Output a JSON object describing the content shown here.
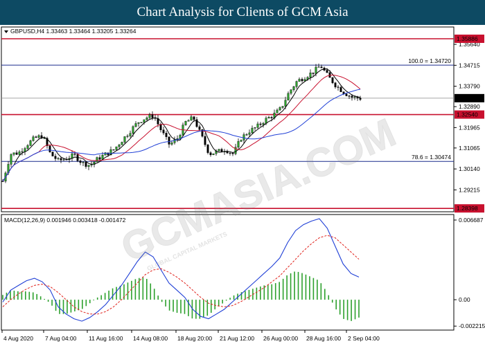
{
  "header": {
    "title": "Chart Analysis for Clients of GCM Asia"
  },
  "watermark": {
    "main": "GCMASIA.COM",
    "sub": "GLOBAL CAPITAL MARKETS"
  },
  "chart_data": [
    {
      "type": "candlestick",
      "info": "GBPUSD,H4  1.33463 1.33464 1.33205 1.33264",
      "ylim": [
        1.2825,
        1.361
      ],
      "y_ticks": [
        "1.35640",
        "1.34715",
        "1.33790",
        "1.32890",
        "1.31965",
        "1.31065",
        "1.30140",
        "1.29215"
      ],
      "x_ticks": [
        "4 Aug 2020",
        "7 Aug 04:00",
        "11 Aug 16:00",
        "14 Aug 08:00",
        "18 Aug 20:00",
        "21 Aug 12:00",
        "26 Aug 00:00",
        "28 Aug 16:00",
        "2 Sep 04:00"
      ],
      "levels": [
        {
          "value": 1.35886,
          "label": "1.35886",
          "color": "#c8102e"
        },
        {
          "value": 1.3254,
          "label": "1.32540",
          "color": "#c8102e"
        },
        {
          "value": 1.28398,
          "label": "1.28398",
          "color": "#c8102e"
        }
      ],
      "fib_levels": [
        {
          "value": 1.3472,
          "text": "100.0 = 1.34720"
        },
        {
          "value": 1.30474,
          "text": "78.6 = 1.30474"
        }
      ],
      "current_price": {
        "value": 1.33264,
        "label": "1.33264"
      },
      "series": [
        {
          "name": "",
          "color": "#000000",
          "key": "ma_fast"
        },
        {
          "name": "",
          "color": "#c8102e",
          "key": "ma_mid"
        },
        {
          "name": "",
          "color": "#1f3fd6",
          "key": "ma_slow"
        }
      ],
      "price_path": [
        1.296,
        1.308,
        1.3085,
        1.312,
        1.315,
        1.316,
        1.308,
        1.305,
        1.306,
        1.3075,
        1.304,
        1.303,
        1.306,
        1.308,
        1.31,
        1.314,
        1.318,
        1.322,
        1.324,
        1.325,
        1.318,
        1.312,
        1.315,
        1.322,
        1.324,
        1.316,
        1.308,
        1.309,
        1.31,
        1.308,
        1.315,
        1.318,
        1.32,
        1.323,
        1.325,
        1.328,
        1.335,
        1.34,
        1.342,
        1.344,
        1.347,
        1.342,
        1.338,
        1.335,
        1.333,
        1.3326
      ]
    },
    {
      "type": "macd",
      "label": "MACD(12,26,9) 0.001946 0.003418 -0.001472",
      "ylim": [
        -0.00255,
        0.00715
      ],
      "y_ticks": [
        "0.006687",
        "0.00",
        "-0.002215"
      ],
      "main_line": [
        -0.0002,
        0.0008,
        0.0012,
        0.0016,
        0.0018,
        0.0015,
        0.0008,
        -0.0006,
        -0.0012,
        -0.0016,
        -0.0018,
        -0.0015,
        -0.001,
        -0.0004,
        0.0004,
        0.0012,
        0.0022,
        0.0032,
        0.004,
        0.0036,
        0.0025,
        0.0014,
        0.0008,
        0.0002,
        -0.0008,
        -0.0014,
        -0.0016,
        -0.0012,
        -0.0008,
        -0.0002,
        0.0004,
        0.001,
        0.0016,
        0.0022,
        0.0028,
        0.0035,
        0.0048,
        0.0058,
        0.0063,
        0.0066,
        0.0068,
        0.006,
        0.0045,
        0.003,
        0.0022,
        0.0019
      ],
      "signal_line": [
        -0.0006,
        0.0,
        0.0005,
        0.0009,
        0.0012,
        0.0013,
        0.0011,
        0.0006,
        0.0,
        -0.0006,
        -0.001,
        -0.0012,
        -0.0012,
        -0.001,
        -0.0006,
        0.0,
        0.0007,
        0.0014,
        0.0021,
        0.0025,
        0.0026,
        0.0023,
        0.0019,
        0.0014,
        0.0008,
        0.0002,
        -0.0003,
        -0.0005,
        -0.0006,
        -0.0005,
        -0.0002,
        0.0002,
        0.0006,
        0.001,
        0.0015,
        0.002,
        0.0027,
        0.0034,
        0.0041,
        0.0047,
        0.0052,
        0.0054,
        0.0052,
        0.0046,
        0.004,
        0.0034
      ]
    }
  ]
}
